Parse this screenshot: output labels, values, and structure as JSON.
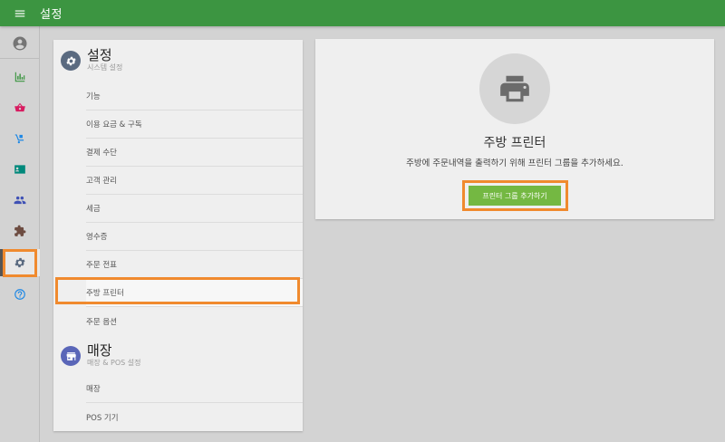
{
  "topbar": {
    "title": "설정"
  },
  "rail": {
    "items": [
      {
        "icon": "account-circle-icon",
        "color": "#757575"
      },
      {
        "icon": "bar-chart-icon",
        "color": "#3c9541"
      },
      {
        "icon": "basket-icon",
        "color": "#d81b60"
      },
      {
        "icon": "hand-truck-icon",
        "color": "#1e88e5"
      },
      {
        "icon": "contact-card-icon",
        "color": "#00897b"
      },
      {
        "icon": "people-icon",
        "color": "#3f51b5"
      },
      {
        "icon": "puzzle-icon",
        "color": "#6d4c41"
      },
      {
        "icon": "gear-icon",
        "color": "#5a6a80"
      },
      {
        "icon": "help-circle-icon",
        "color": "#1e88e5"
      }
    ]
  },
  "settings": {
    "title": "설정",
    "subtitle": "시스템 설정",
    "items": [
      "기능",
      "이용 요금 & 구독",
      "결제 수단",
      "고객 관리",
      "세금",
      "영수증",
      "주문 전표",
      "주방 프린터",
      "주문 옵션"
    ]
  },
  "store": {
    "title": "매장",
    "subtitle": "매장 & POS 설정",
    "items": [
      "매장",
      "POS 기기"
    ]
  },
  "content": {
    "title": "주방 프린터",
    "description": "주방에 주문내역을 출력하기 위해 프린터 그룹을 추가하세요.",
    "add_button": "프린터 그룹 추가하기"
  },
  "colors": {
    "accent": "#3c9541",
    "button": "#74b842",
    "highlight": "#f08a2e"
  }
}
